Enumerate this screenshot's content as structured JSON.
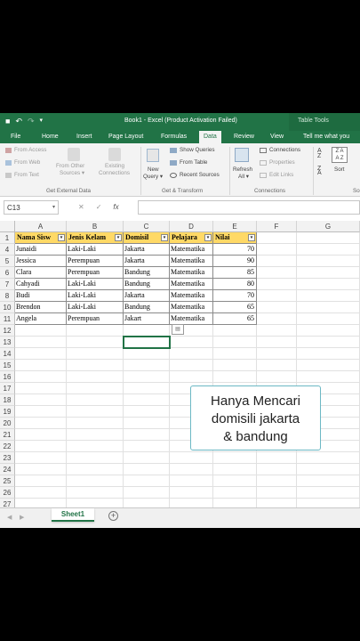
{
  "window": {
    "title": "Book1 - Excel (Product Activation Failed)",
    "context_tab": "Table Tools",
    "accent": "#217346"
  },
  "tabs": [
    "File",
    "Home",
    "Insert",
    "Page Layout",
    "Formulas",
    "Data",
    "Review",
    "View",
    "Tell me what you"
  ],
  "active_tab": "Data",
  "ribbon": {
    "get_external": {
      "from_access": "From Access",
      "from_web": "From Web",
      "from_text": "From Text",
      "from_other_1": "From Other",
      "from_other_2": "Sources ▾",
      "existing_1": "Existing",
      "existing_2": "Connections",
      "label": "Get External Data"
    },
    "get_transform": {
      "new_query_1": "New",
      "new_query_2": "Query ▾",
      "show_queries": "Show Queries",
      "from_table": "From Table",
      "recent_sources": "Recent Sources",
      "label": "Get & Transform"
    },
    "connections": {
      "refresh_1": "Refresh",
      "refresh_2": "All ▾",
      "connections": "Connections",
      "properties": "Properties",
      "edit_links": "Edit Links",
      "label": "Connections"
    },
    "sort": {
      "sort": "Sort",
      "label": "So"
    }
  },
  "formula_bar": {
    "name_box": "C13",
    "fx": "fx",
    "value": ""
  },
  "columns": [
    "A",
    "B",
    "C",
    "D",
    "E",
    "F",
    "G"
  ],
  "rows": [
    "1",
    "4",
    "5",
    "6",
    "7",
    "8",
    "10",
    "11",
    "12",
    "13",
    "14",
    "15",
    "16",
    "17",
    "18",
    "19",
    "20",
    "21",
    "22",
    "23",
    "24",
    "25",
    "26",
    "27"
  ],
  "table": {
    "headers": [
      "Nama Sisw",
      "Jenis Kelam",
      "Domisil",
      "Pelajara",
      "Nilai"
    ],
    "records": [
      [
        "Junaidi",
        "Laki-Laki",
        "Jakarta",
        "Matematika",
        "70"
      ],
      [
        "Jessica",
        "Perempuan",
        "Jakarta",
        "Matematika",
        "90"
      ],
      [
        "Clara",
        "Perempuan",
        "Bandung",
        "Matematika",
        "85"
      ],
      [
        "Cahyadi",
        "Laki-Laki",
        "Bandung",
        "Matematika",
        "80"
      ],
      [
        "Budi",
        "Laki-Laki",
        "Jakarta",
        "Matematika",
        "70"
      ],
      [
        "Brendon",
        "Laki-Laki",
        "Bandung",
        "Matematika",
        "65"
      ],
      [
        "Angela",
        "Perempuan",
        "Jakart",
        "Matematika",
        "65"
      ]
    ],
    "header_fill": "#ffd966"
  },
  "annotation": {
    "line1": "Hanya Mencari",
    "line2": "domisili jakarta",
    "line3": "& bandung"
  },
  "sheets": {
    "active": "Sheet1"
  }
}
